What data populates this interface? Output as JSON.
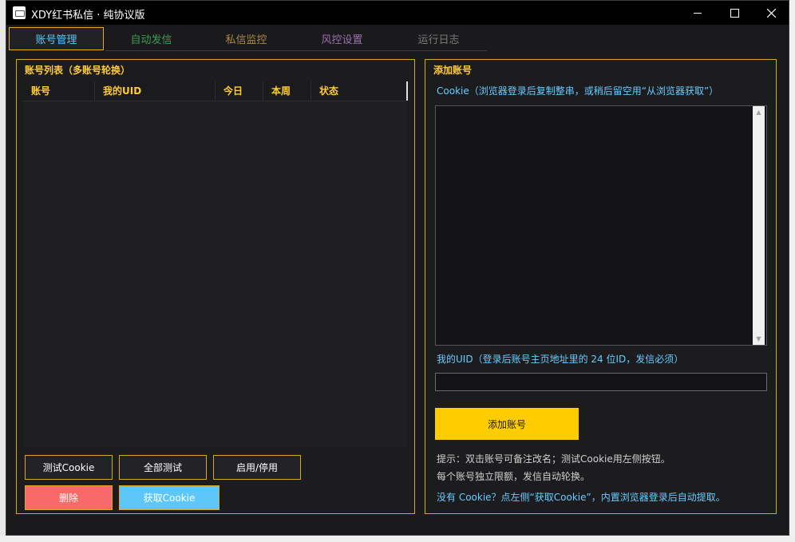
{
  "window": {
    "title": "XDY红书私信 · 纯协议版"
  },
  "tabs": [
    {
      "label": "账号管理",
      "color": "#5ec4f5"
    },
    {
      "label": "自动发信",
      "color": "#3d9b55"
    },
    {
      "label": "私信监控",
      "color": "#a98a4a"
    },
    {
      "label": "风控设置",
      "color": "#9a6fb0"
    },
    {
      "label": "运行日志",
      "color": "#7a7a7a"
    }
  ],
  "account_list": {
    "title": "账号列表（多账号轮换）",
    "columns": [
      "账号",
      "我的UID",
      "今日",
      "本周",
      "状态"
    ],
    "rows": []
  },
  "buttons": {
    "test_cookie": "测试Cookie",
    "test_all": "全部测试",
    "enable_disable": "启用/停用",
    "delete": "删除",
    "get_cookie": "获取Cookie"
  },
  "add_account": {
    "title": "添加账号",
    "cookie_label": "Cookie（浏览器登录后复制整串，或稍后留空用“从浏览器获取”）",
    "cookie_value": "",
    "uid_label": "我的UID（登录后账号主页地址里的 24 位ID，发信必须）",
    "uid_value": "",
    "add_button": "添加账号",
    "hint1": "提示：双击账号可备注改名；测试Cookie用左侧按钮。",
    "hint2": "每个账号独立限额，发信自动轮换。",
    "hint3": "没有 Cookie？点左侧“获取Cookie”，内置浏览器登录后自动提取。"
  },
  "colors": {
    "accent_gold": "#d9a821",
    "title_yellow": "#ffcc33",
    "label_blue": "#66ccff",
    "danger": "#f86969",
    "info": "#5dc8f7",
    "primary_yellow": "#ffcc00"
  }
}
